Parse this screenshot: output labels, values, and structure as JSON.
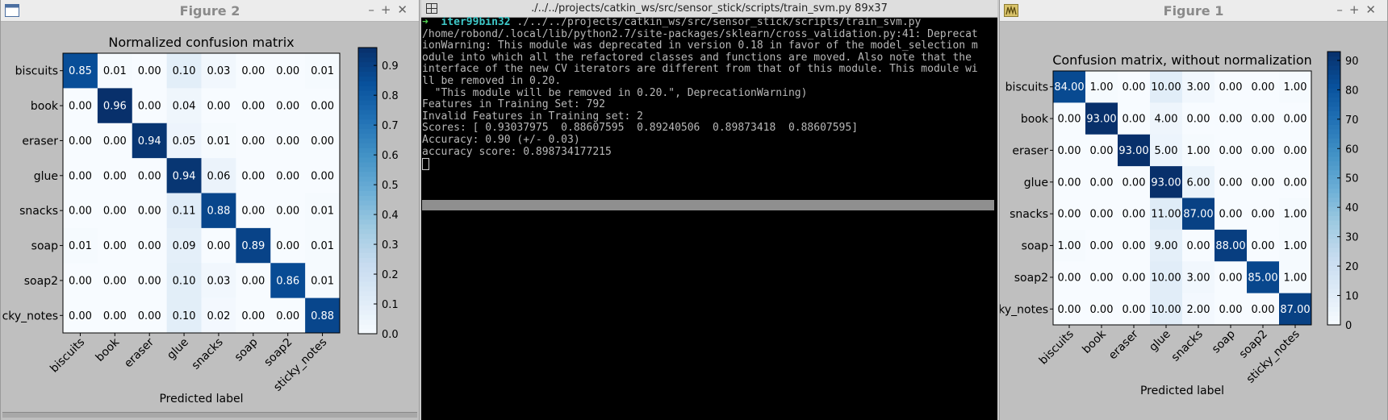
{
  "left_window": {
    "title": "Figure 2",
    "icon": "figure-window-icon",
    "controls": [
      "–",
      "+",
      "✕"
    ]
  },
  "right_window": {
    "title": "Figure 1",
    "icon": "matplotlib-logo-icon",
    "controls": [
      "–",
      "+",
      "✕"
    ]
  },
  "terminal": {
    "title": "./../../projects/catkin_ws/src/sensor_stick/scripts/train_svm.py 89x37",
    "prompt_arrow": "➜",
    "prompt_user": "iter99bin32",
    "command": "./../../projects/catkin_ws/src/sensor_stick/scripts/train_svm.py",
    "output_lines": [
      "/home/robond/.local/lib/python2.7/site-packages/sklearn/cross_validation.py:41: Deprecat",
      "ionWarning: This module was deprecated in version 0.18 in favor of the model_selection m",
      "odule into which all the refactored classes and functions are moved. Also note that the",
      "interface of the new CV iterators are different from that of this module. This module wi",
      "ll be removed in 0.20.",
      "  \"This module will be removed in 0.20.\", DeprecationWarning)",
      "Features in Training Set: 792",
      "Invalid Features in Training set: 2",
      "Scores: [ 0.93037975  0.88607595  0.89240506  0.89873418  0.88607595]",
      "Accuracy: 0.90 (+/- 0.03)",
      "accuracy score: 0.898734177215"
    ]
  },
  "chart_data": [
    {
      "type": "heatmap",
      "title": "Normalized confusion matrix",
      "xlabel": "Predicted label",
      "ylabel": "",
      "x_tick_labels": [
        "biscuits",
        "book",
        "eraser",
        "glue",
        "snacks",
        "soap",
        "soap2",
        "sticky_notes"
      ],
      "y_tick_labels": [
        "biscuits",
        "book",
        "eraser",
        "glue",
        "snacks",
        "soap",
        "soap2",
        "cky_notes"
      ],
      "cell_labels": [
        [
          "0.85",
          "0.01",
          "0.00",
          "0.10",
          "0.03",
          "0.00",
          "0.00",
          "0.01"
        ],
        [
          "0.00",
          "0.96",
          "0.00",
          "0.04",
          "0.00",
          "0.00",
          "0.00",
          "0.00"
        ],
        [
          "0.00",
          "0.00",
          "0.94",
          "0.05",
          "0.01",
          "0.00",
          "0.00",
          "0.00"
        ],
        [
          "0.00",
          "0.00",
          "0.00",
          "0.94",
          "0.06",
          "0.00",
          "0.00",
          "0.00"
        ],
        [
          "0.00",
          "0.00",
          "0.00",
          "0.11",
          "0.88",
          "0.00",
          "0.00",
          "0.01"
        ],
        [
          "0.01",
          "0.00",
          "0.00",
          "0.09",
          "0.00",
          "0.89",
          "0.00",
          "0.01"
        ],
        [
          "0.00",
          "0.00",
          "0.00",
          "0.10",
          "0.03",
          "0.00",
          "0.86",
          "0.01"
        ],
        [
          "0.00",
          "0.00",
          "0.00",
          "0.10",
          "0.02",
          "0.00",
          "0.00",
          "0.88"
        ]
      ],
      "vmax": 0.96,
      "colorbar_ticks": [
        "0.0",
        "0.1",
        "0.2",
        "0.3",
        "0.4",
        "0.5",
        "0.6",
        "0.7",
        "0.8",
        "0.9"
      ],
      "colormap": "Blues",
      "grid": false
    },
    {
      "type": "heatmap",
      "title": "Confusion matrix, without normalization",
      "xlabel": "Predicted label",
      "ylabel": "",
      "x_tick_labels": [
        "biscuits",
        "book",
        "eraser",
        "glue",
        "snacks",
        "soap",
        "soap2",
        "sticky_notes"
      ],
      "y_tick_labels": [
        "biscuits",
        "book",
        "eraser",
        "glue",
        "snacks",
        "soap",
        "soap2",
        "ky_notes"
      ],
      "cell_labels": [
        [
          "84.00",
          "1.00",
          "0.00",
          "10.00",
          "3.00",
          "0.00",
          "0.00",
          "1.00"
        ],
        [
          "0.00",
          "93.00",
          "0.00",
          "4.00",
          "0.00",
          "0.00",
          "0.00",
          "0.00"
        ],
        [
          "0.00",
          "0.00",
          "93.00",
          "5.00",
          "1.00",
          "0.00",
          "0.00",
          "0.00"
        ],
        [
          "0.00",
          "0.00",
          "0.00",
          "93.00",
          "6.00",
          "0.00",
          "0.00",
          "0.00"
        ],
        [
          "0.00",
          "0.00",
          "0.00",
          "11.00",
          "87.00",
          "0.00",
          "0.00",
          "1.00"
        ],
        [
          "1.00",
          "0.00",
          "0.00",
          "9.00",
          "0.00",
          "88.00",
          "0.00",
          "1.00"
        ],
        [
          "0.00",
          "0.00",
          "0.00",
          "10.00",
          "3.00",
          "0.00",
          "85.00",
          "1.00"
        ],
        [
          "0.00",
          "0.00",
          "0.00",
          "10.00",
          "2.00",
          "0.00",
          "0.00",
          "87.00"
        ]
      ],
      "vmax": 93,
      "colorbar_ticks": [
        "0",
        "10",
        "20",
        "30",
        "40",
        "50",
        "60",
        "70",
        "80",
        "90"
      ],
      "colormap": "Blues",
      "grid": false
    }
  ]
}
